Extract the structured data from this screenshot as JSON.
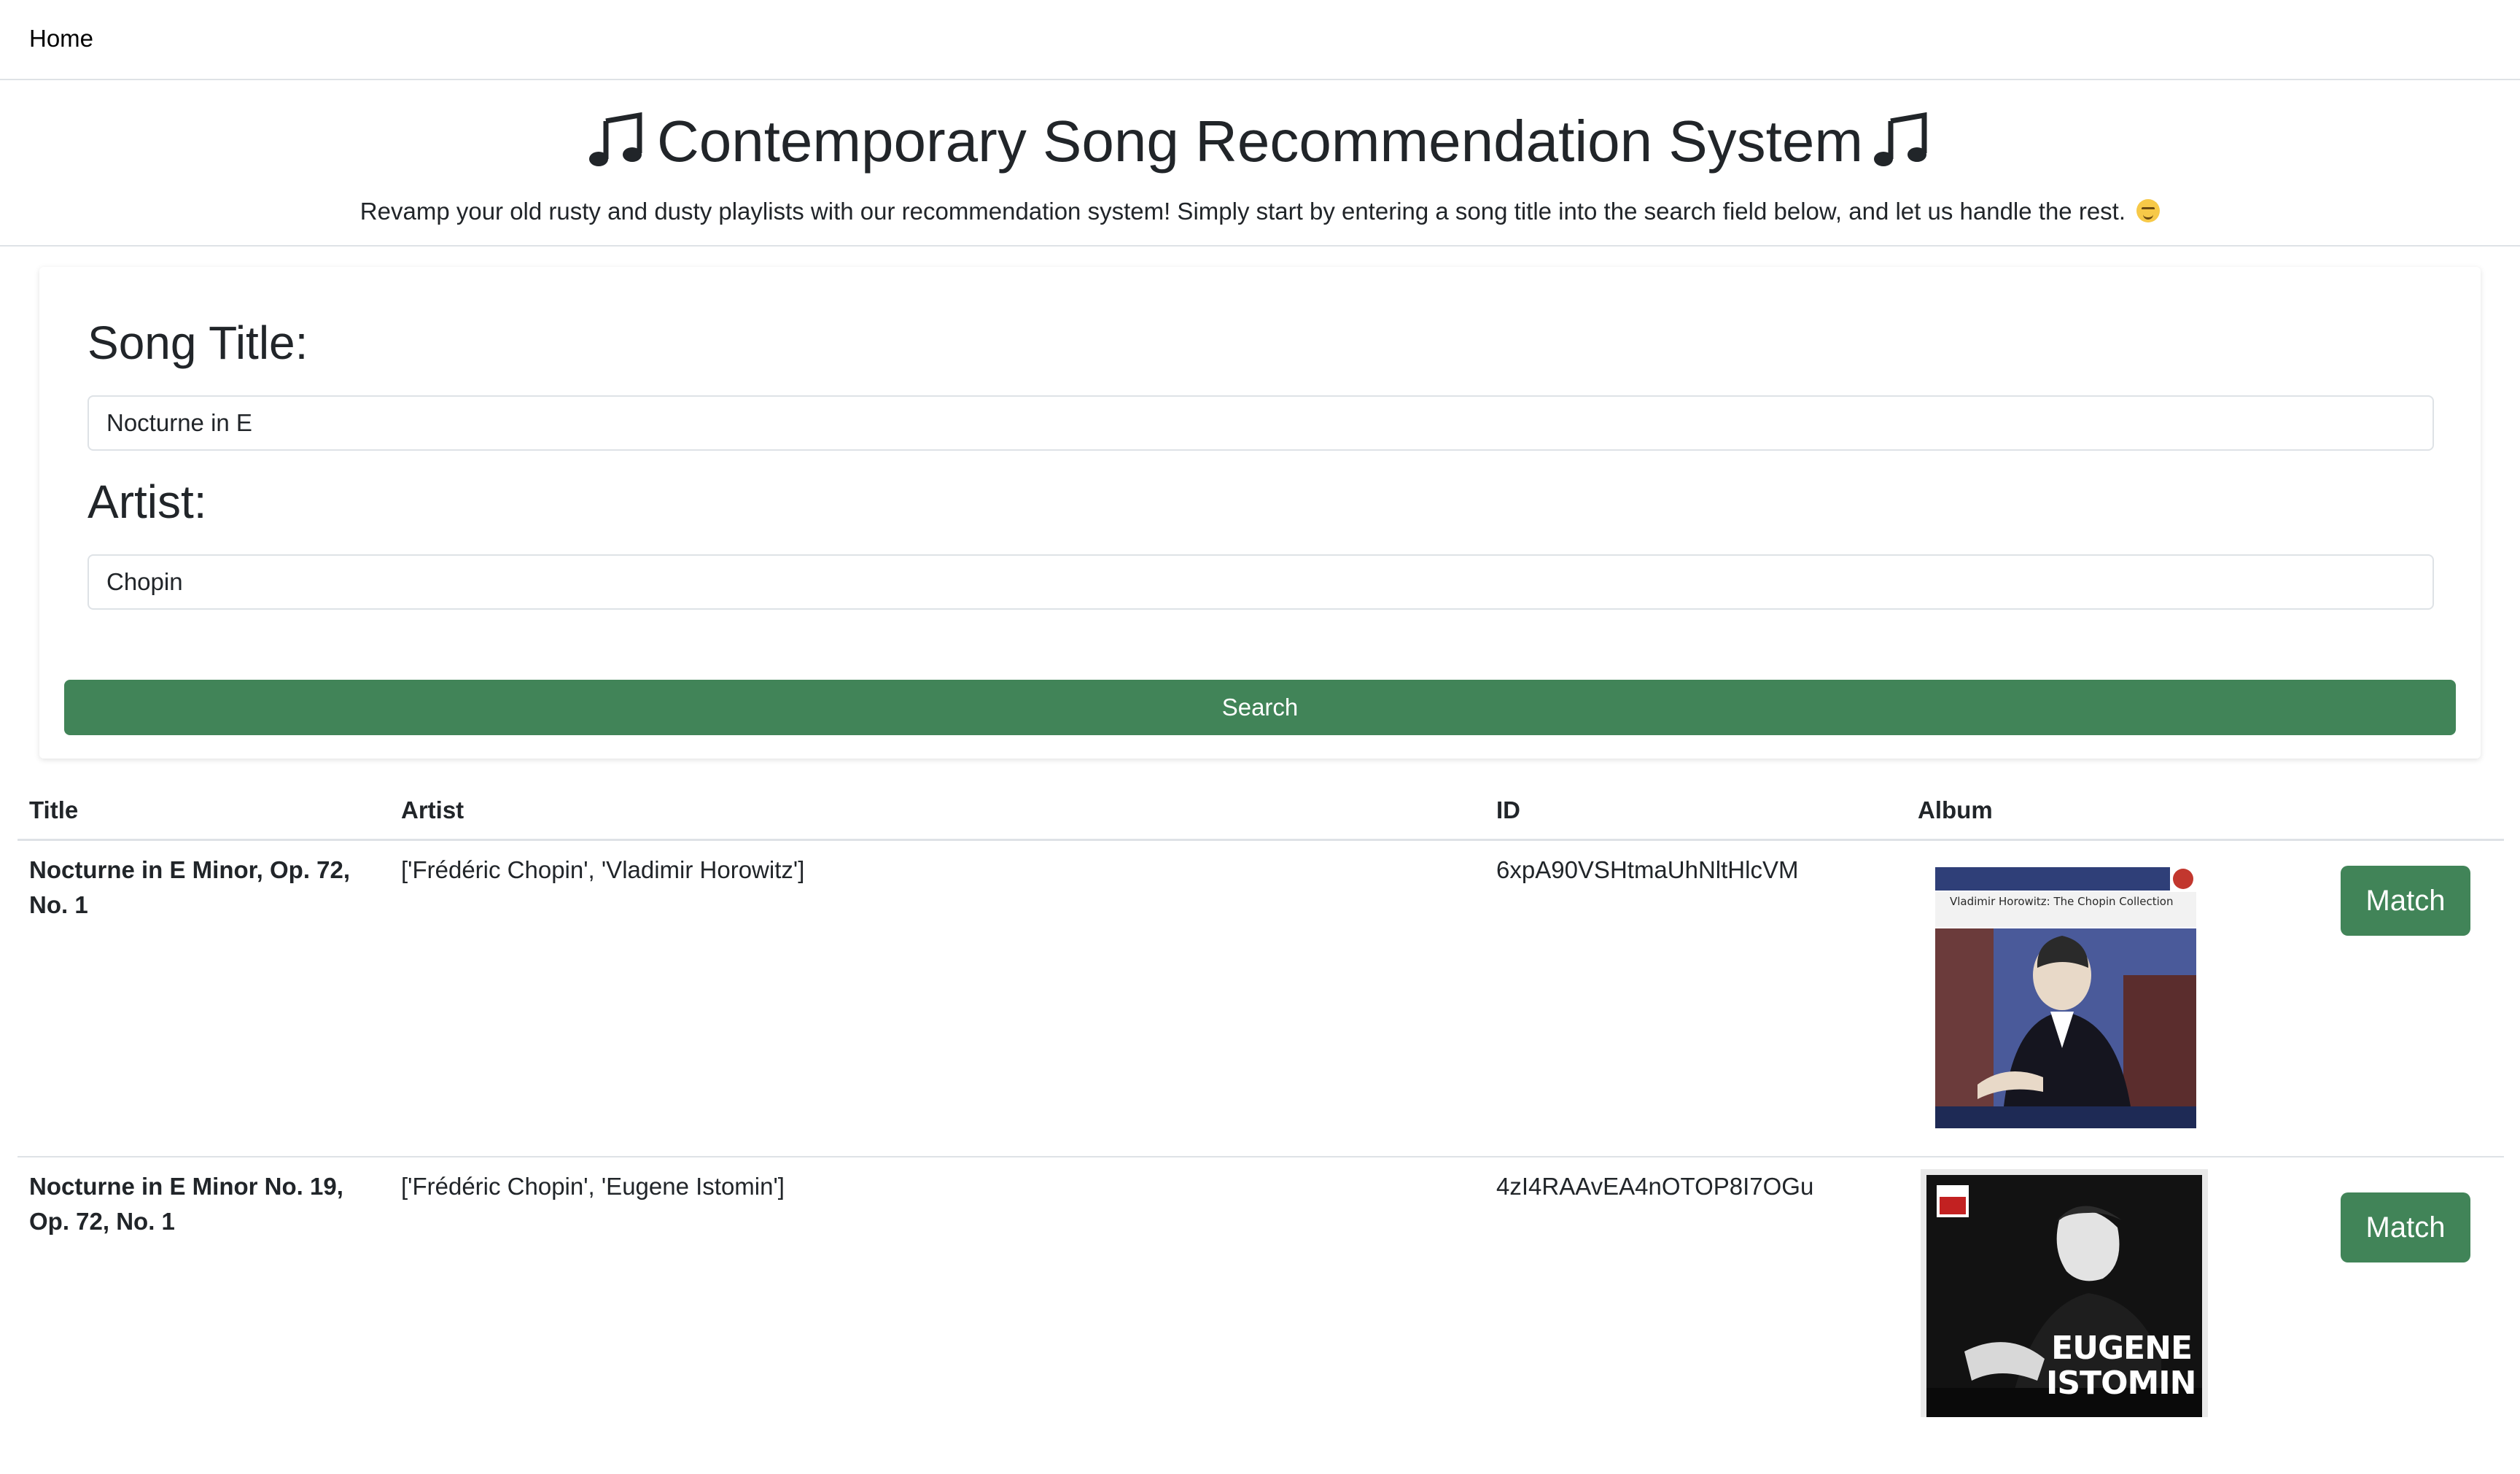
{
  "nav": {
    "home_label": "Home"
  },
  "header": {
    "title": "Contemporary Song Recommendation System",
    "subtitle": "Revamp your old rusty and dusty playlists with our recommendation system! Simply start by entering a song title into the search field below, and let us handle the rest."
  },
  "search": {
    "song_title_label": "Song Title:",
    "song_title_value": "Nocturne in E",
    "artist_label": "Artist:",
    "artist_value": "Chopin",
    "button_label": "Search"
  },
  "results": {
    "columns": [
      "Title",
      "Artist",
      "ID",
      "Album"
    ],
    "rows": [
      {
        "title": "Nocturne in E Minor, Op. 72, No. 1",
        "artist": "['Frédéric Chopin', 'Vladimir Horowitz']",
        "id": "6xpA90VSHtmaUhNltHlcVM",
        "album_cover_text": "Vladimir Horowitz: The Chopin Collection",
        "match_label": "Match"
      },
      {
        "title": "Nocturne in E Minor No. 19, Op. 72, No. 1",
        "artist": "['Frédéric Chopin', 'Eugene Istomin']",
        "id": "4zI4RAAvEA4nOTOP8I7OGu",
        "album_cover_text": "EUGENE ISTOMIN",
        "match_label": "Match"
      }
    ]
  },
  "colors": {
    "accent_green": "#418458",
    "border": "#dee2e6",
    "text": "#212529"
  },
  "icons": [
    "music-note-icon",
    "smirk-emoji-icon"
  ]
}
